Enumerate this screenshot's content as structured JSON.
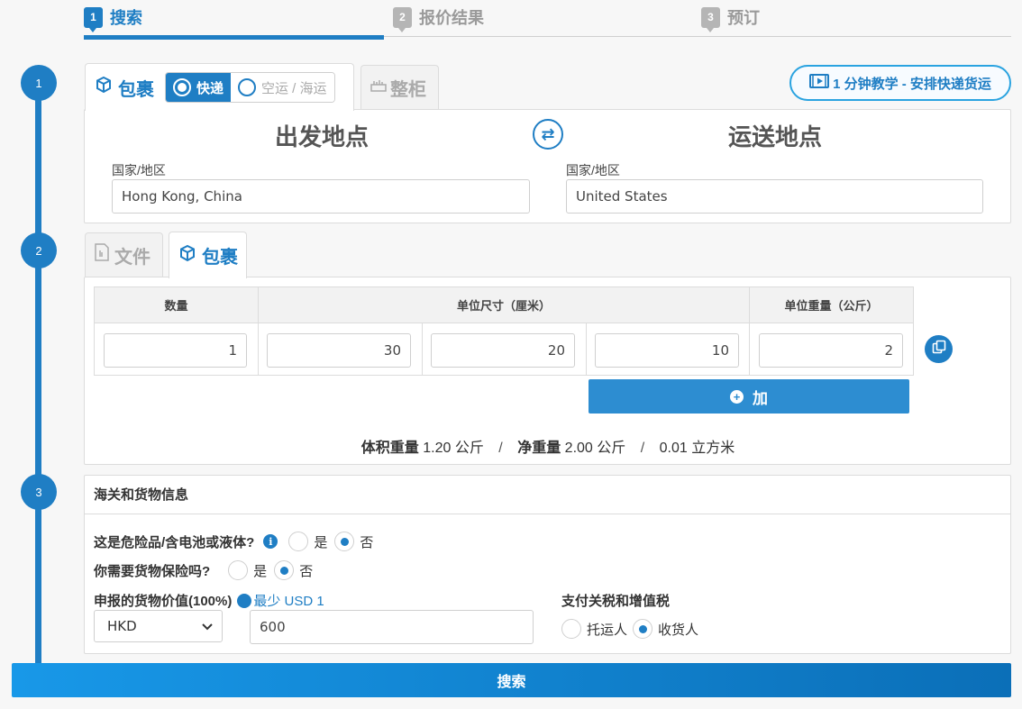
{
  "steps": [
    {
      "num": "1",
      "label": "搜索",
      "active": true
    },
    {
      "num": "2",
      "label": "报价结果",
      "active": false
    },
    {
      "num": "3",
      "label": "预订",
      "active": false
    }
  ],
  "timeline": [
    "1",
    "2",
    "3"
  ],
  "shipment": {
    "tab_parcel": "包裹",
    "tab_container": "整柜",
    "mode_express": "快递",
    "mode_air_sea": "空运 / 海运",
    "tutorial": "1 分钟教学 - 安排快递货运"
  },
  "origin": {
    "title": "出发地点",
    "label": "国家/地区",
    "value": "Hong Kong, China"
  },
  "destination": {
    "title": "运送地点",
    "label": "国家/地区",
    "value": "United States"
  },
  "package": {
    "tab_document": "文件",
    "tab_parcel": "包裹",
    "headers": {
      "qty": "数量",
      "dims": "单位尺寸（厘米）",
      "weight": "单位重量（公斤）"
    },
    "row": {
      "qty": "1",
      "length": "30",
      "width": "20",
      "height": "10",
      "weight": "2"
    },
    "add": "加"
  },
  "summary": {
    "vol_label": "体积重量",
    "vol_value": "1.20 公斤",
    "net_label": "净重量",
    "net_value": "2.00 公斤",
    "cbm": "0.01 立方米",
    "sep": "/"
  },
  "customs": {
    "title": "海关和货物信息",
    "dangerous_q": "这是危险品/含电池或液体?",
    "insurance_q": "你需要货物保险吗?",
    "yes": "是",
    "no": "否",
    "declared_label": "申报的货物价值(100%)",
    "min_note": "最少 USD 1",
    "currency": "HKD",
    "declared_value": "600",
    "duty_label": "支付关税和增值税",
    "shipper": "托运人",
    "receiver": "收货人"
  },
  "search_button": "搜索"
}
